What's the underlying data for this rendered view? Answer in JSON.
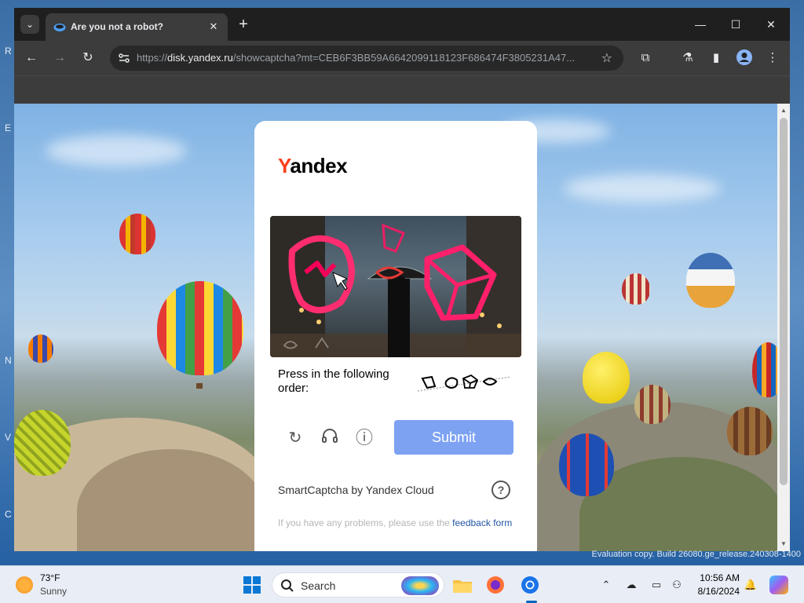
{
  "desktop": {
    "side_letters": [
      "R",
      "E",
      "N",
      "V",
      "C"
    ]
  },
  "browser": {
    "tab": {
      "title": "Are you not a robot?",
      "favicon": "yandex-disk-icon",
      "close": "✕"
    },
    "new_tab": "+",
    "window_controls": {
      "minimize": "—",
      "maximize": "☐",
      "close": "✕"
    },
    "nav": {
      "back": "←",
      "forward": "→",
      "reload": "↻"
    },
    "url": {
      "prefix": "https://",
      "host": "disk.yandex.ru",
      "path": "/showcaptcha?mt=CEB6F3BB59A6642099118123F686474F3805231A47..."
    },
    "icons": [
      "extensions-icon",
      "labs-icon",
      "side-panel-icon",
      "profile-icon",
      "menu-icon"
    ]
  },
  "captcha": {
    "logo_first": "Y",
    "logo_rest": "andex",
    "instruction": "Press in the following order:",
    "order_icons": [
      "flag-shape",
      "blob-shape",
      "cube-shape",
      "crescent-shape"
    ],
    "image_icons": [
      "zigzag-shape",
      "flag-shape",
      "crescent-shape",
      "cube-shape",
      "blob-shape",
      "leaf-shape"
    ],
    "buttons": {
      "reload": "↻",
      "audio": "🎧",
      "info": "ⓘ",
      "submit": "Submit"
    },
    "brand": "SmartCaptcha by Yandex Cloud",
    "help": "?",
    "problem_text": "If you have any problems, please use the",
    "problem_link": "feedback form"
  },
  "watermark": "Evaluation copy. Build 26080.ge_release.240308-1400",
  "taskbar": {
    "weather": {
      "temp": "73°F",
      "condition": "Sunny"
    },
    "search_label": "Search",
    "apps": [
      "start-icon",
      "search-icon",
      "widgets-icon",
      "file-explorer-icon",
      "firefox-icon",
      "chrome-icon"
    ],
    "tray": [
      "chevron-up-icon",
      "network-off-icon",
      "display-icon",
      "accessibility-icon"
    ],
    "clock": {
      "time": "10:56 AM",
      "date": "8/16/2024"
    },
    "colors": {
      "accent": "#0067c0"
    }
  }
}
